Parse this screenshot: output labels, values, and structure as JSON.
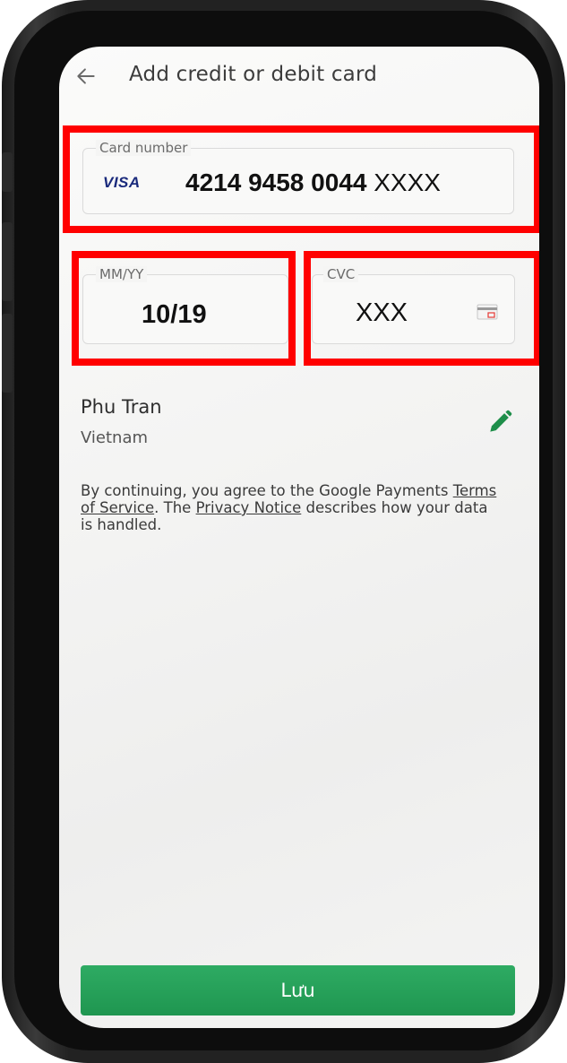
{
  "header": {
    "back_icon": "arrow-left-icon",
    "title": "Add credit or debit card"
  },
  "card_number": {
    "label": "Card number",
    "brand": "VISA",
    "digits_bold": "4214 9458 0044",
    "digits_masked": "XXXX"
  },
  "expiry": {
    "label": "MM/YY",
    "value": "10/19"
  },
  "cvc": {
    "label": "CVC",
    "value": "XXX",
    "icon": "card-back-icon"
  },
  "billing": {
    "name": "Phu Tran",
    "country": "Vietnam",
    "edit_icon": "pencil-icon"
  },
  "terms": {
    "prefix": "By continuing, you agree to the Google Payments ",
    "terms_link": "Terms of Service",
    "middle": ". The ",
    "privacy_link": "Privacy Notice",
    "suffix": " describes how your data is handled."
  },
  "actions": {
    "save_label": "Lưu"
  },
  "colors": {
    "accent": "#1f9650",
    "highlight_box": "#ff0000",
    "visa_blue": "#1a2a7c"
  }
}
